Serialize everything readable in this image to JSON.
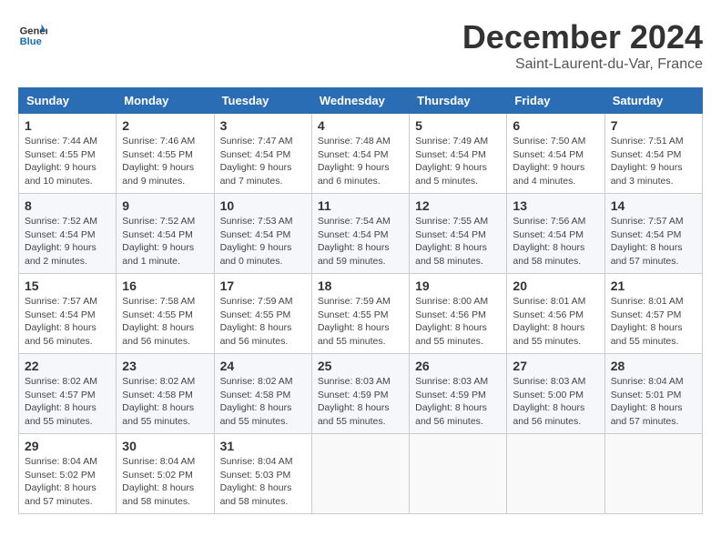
{
  "header": {
    "logo_line1": "General",
    "logo_line2": "Blue",
    "month": "December 2024",
    "location": "Saint-Laurent-du-Var, France"
  },
  "weekdays": [
    "Sunday",
    "Monday",
    "Tuesday",
    "Wednesday",
    "Thursday",
    "Friday",
    "Saturday"
  ],
  "weeks": [
    [
      {
        "day": "1",
        "info": "Sunrise: 7:44 AM\nSunset: 4:55 PM\nDaylight: 9 hours\nand 10 minutes."
      },
      {
        "day": "2",
        "info": "Sunrise: 7:46 AM\nSunset: 4:55 PM\nDaylight: 9 hours\nand 9 minutes."
      },
      {
        "day": "3",
        "info": "Sunrise: 7:47 AM\nSunset: 4:54 PM\nDaylight: 9 hours\nand 7 minutes."
      },
      {
        "day": "4",
        "info": "Sunrise: 7:48 AM\nSunset: 4:54 PM\nDaylight: 9 hours\nand 6 minutes."
      },
      {
        "day": "5",
        "info": "Sunrise: 7:49 AM\nSunset: 4:54 PM\nDaylight: 9 hours\nand 5 minutes."
      },
      {
        "day": "6",
        "info": "Sunrise: 7:50 AM\nSunset: 4:54 PM\nDaylight: 9 hours\nand 4 minutes."
      },
      {
        "day": "7",
        "info": "Sunrise: 7:51 AM\nSunset: 4:54 PM\nDaylight: 9 hours\nand 3 minutes."
      }
    ],
    [
      {
        "day": "8",
        "info": "Sunrise: 7:52 AM\nSunset: 4:54 PM\nDaylight: 9 hours\nand 2 minutes."
      },
      {
        "day": "9",
        "info": "Sunrise: 7:52 AM\nSunset: 4:54 PM\nDaylight: 9 hours\nand 1 minute."
      },
      {
        "day": "10",
        "info": "Sunrise: 7:53 AM\nSunset: 4:54 PM\nDaylight: 9 hours\nand 0 minutes."
      },
      {
        "day": "11",
        "info": "Sunrise: 7:54 AM\nSunset: 4:54 PM\nDaylight: 8 hours\nand 59 minutes."
      },
      {
        "day": "12",
        "info": "Sunrise: 7:55 AM\nSunset: 4:54 PM\nDaylight: 8 hours\nand 58 minutes."
      },
      {
        "day": "13",
        "info": "Sunrise: 7:56 AM\nSunset: 4:54 PM\nDaylight: 8 hours\nand 58 minutes."
      },
      {
        "day": "14",
        "info": "Sunrise: 7:57 AM\nSunset: 4:54 PM\nDaylight: 8 hours\nand 57 minutes."
      }
    ],
    [
      {
        "day": "15",
        "info": "Sunrise: 7:57 AM\nSunset: 4:54 PM\nDaylight: 8 hours\nand 56 minutes."
      },
      {
        "day": "16",
        "info": "Sunrise: 7:58 AM\nSunset: 4:55 PM\nDaylight: 8 hours\nand 56 minutes."
      },
      {
        "day": "17",
        "info": "Sunrise: 7:59 AM\nSunset: 4:55 PM\nDaylight: 8 hours\nand 56 minutes."
      },
      {
        "day": "18",
        "info": "Sunrise: 7:59 AM\nSunset: 4:55 PM\nDaylight: 8 hours\nand 55 minutes."
      },
      {
        "day": "19",
        "info": "Sunrise: 8:00 AM\nSunset: 4:56 PM\nDaylight: 8 hours\nand 55 minutes."
      },
      {
        "day": "20",
        "info": "Sunrise: 8:01 AM\nSunset: 4:56 PM\nDaylight: 8 hours\nand 55 minutes."
      },
      {
        "day": "21",
        "info": "Sunrise: 8:01 AM\nSunset: 4:57 PM\nDaylight: 8 hours\nand 55 minutes."
      }
    ],
    [
      {
        "day": "22",
        "info": "Sunrise: 8:02 AM\nSunset: 4:57 PM\nDaylight: 8 hours\nand 55 minutes."
      },
      {
        "day": "23",
        "info": "Sunrise: 8:02 AM\nSunset: 4:58 PM\nDaylight: 8 hours\nand 55 minutes."
      },
      {
        "day": "24",
        "info": "Sunrise: 8:02 AM\nSunset: 4:58 PM\nDaylight: 8 hours\nand 55 minutes."
      },
      {
        "day": "25",
        "info": "Sunrise: 8:03 AM\nSunset: 4:59 PM\nDaylight: 8 hours\nand 55 minutes."
      },
      {
        "day": "26",
        "info": "Sunrise: 8:03 AM\nSunset: 4:59 PM\nDaylight: 8 hours\nand 56 minutes."
      },
      {
        "day": "27",
        "info": "Sunrise: 8:03 AM\nSunset: 5:00 PM\nDaylight: 8 hours\nand 56 minutes."
      },
      {
        "day": "28",
        "info": "Sunrise: 8:04 AM\nSunset: 5:01 PM\nDaylight: 8 hours\nand 57 minutes."
      }
    ],
    [
      {
        "day": "29",
        "info": "Sunrise: 8:04 AM\nSunset: 5:02 PM\nDaylight: 8 hours\nand 57 minutes."
      },
      {
        "day": "30",
        "info": "Sunrise: 8:04 AM\nSunset: 5:02 PM\nDaylight: 8 hours\nand 58 minutes."
      },
      {
        "day": "31",
        "info": "Sunrise: 8:04 AM\nSunset: 5:03 PM\nDaylight: 8 hours\nand 58 minutes."
      },
      {
        "day": "",
        "info": ""
      },
      {
        "day": "",
        "info": ""
      },
      {
        "day": "",
        "info": ""
      },
      {
        "day": "",
        "info": ""
      }
    ]
  ]
}
